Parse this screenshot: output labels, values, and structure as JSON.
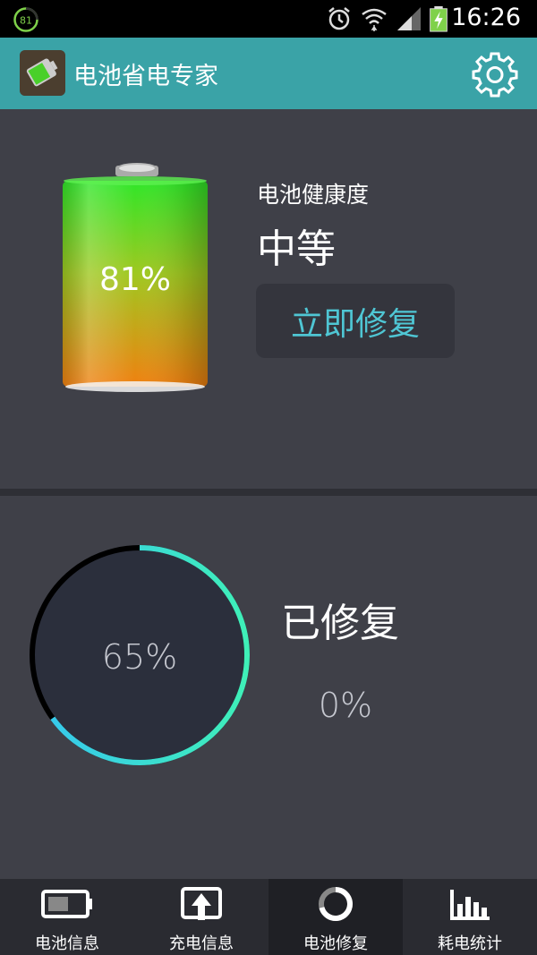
{
  "status_bar": {
    "battery_badge": "81",
    "time": "16:26"
  },
  "app_bar": {
    "title": "电池省电专家"
  },
  "battery": {
    "percent_text": "81%",
    "level": 0.81
  },
  "health": {
    "label": "电池健康度",
    "value": "中等",
    "fix_button": "立即修复"
  },
  "repair": {
    "ring_percent_text": "65%",
    "ring_progress": 0.65,
    "fixed_label": "已修复",
    "fixed_percent": "0%"
  },
  "bottom_nav": {
    "items": [
      {
        "label": "电池信息",
        "icon": "battery-icon",
        "active": false
      },
      {
        "label": "充电信息",
        "icon": "upload-icon",
        "active": false
      },
      {
        "label": "电池修复",
        "icon": "repair-ring-icon",
        "active": true
      },
      {
        "label": "耗电统计",
        "icon": "bar-chart-icon",
        "active": false
      }
    ]
  },
  "colors": {
    "app_bar": "#3aa3a7",
    "accent_text": "#4fc6d4",
    "ring_start": "#36c6f0",
    "ring_end": "#3ff0b8",
    "battery_top": "#2fe628",
    "battery_bottom": "#f08010"
  }
}
